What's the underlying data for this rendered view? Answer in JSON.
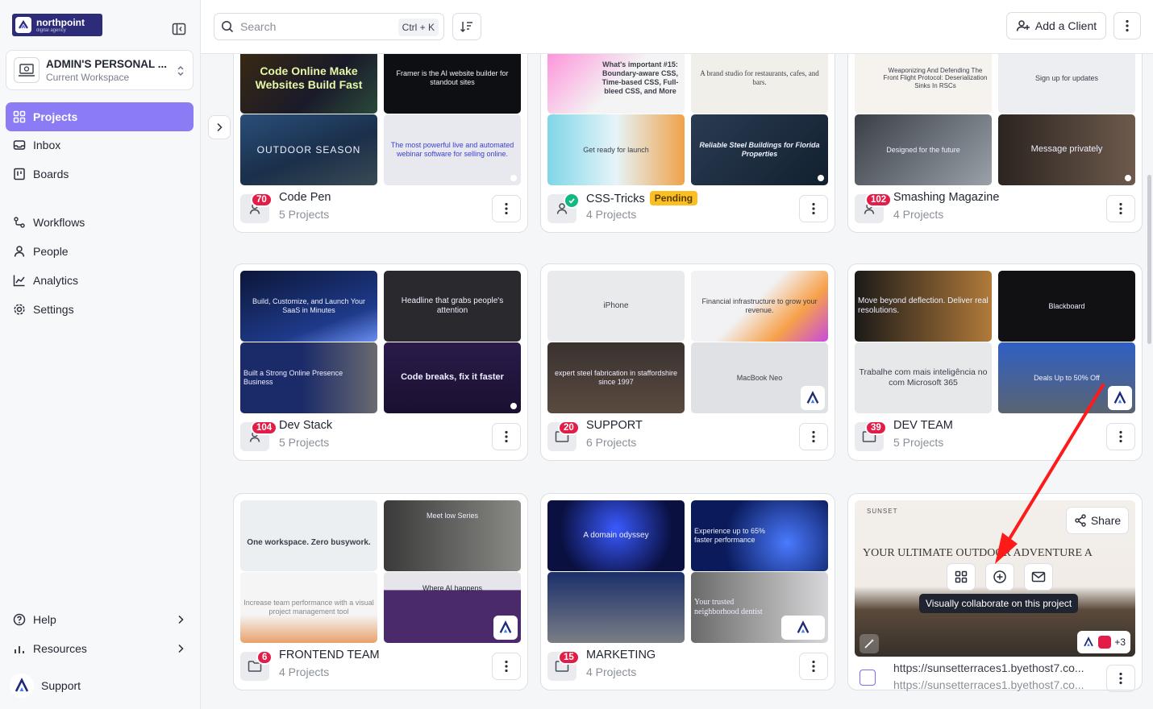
{
  "brand": {
    "name": "northpoint",
    "tagline": "digital agency"
  },
  "workspace": {
    "title": "ADMIN'S PERSONAL ...",
    "subtitle": "Current Workspace"
  },
  "nav": {
    "projects": "Projects",
    "inbox": "Inbox",
    "boards": "Boards",
    "workflows": "Workflows",
    "people": "People",
    "analytics": "Analytics",
    "settings": "Settings",
    "help": "Help",
    "resources": "Resources",
    "support": "Support"
  },
  "topbar": {
    "search_placeholder": "Search",
    "shortcut": "Ctrl + K",
    "add_client": "Add a Client"
  },
  "cards": [
    {
      "name": "Code Pen",
      "count": "70",
      "projects": "5 Projects",
      "thumbs": [
        "Code Online Make Websites Build Fast",
        "Framer is the AI website builder for standout sites",
        "OUTDOOR SEASON",
        "The most powerful live and automated webinar software for selling online."
      ]
    },
    {
      "name": "CSS-Tricks",
      "badge": "Pending",
      "projects": "4 Projects",
      "thumbs": [
        "What's important #15: Boundary-aware CSS, Time-based CSS, Full-bleed CSS, and More",
        "A brand studio for restaurants, cafes, and bars.",
        "Get ready for launch",
        "Reliable Steel Buildings for Florida Properties"
      ]
    },
    {
      "name": "Smashing Magazine",
      "count": "102",
      "projects": "4 Projects",
      "thumbs": [
        "Weaponizing And Defending The Front Flight Protocol: Deserialization Sinks In RSCs",
        "Sign up for updates",
        "Designed for the future",
        "Message privately"
      ]
    },
    {
      "name": "Dev Stack",
      "count": "104",
      "projects": "5 Projects",
      "thumbs": [
        "Build, Customize, and Launch Your SaaS in Minutes",
        "Headline that grabs people's attention",
        "Built a Strong Online Presence Business",
        "Code breaks, fix it faster"
      ]
    },
    {
      "name": "SUPPORT",
      "count": "20",
      "projects": "6 Projects",
      "thumbs": [
        "iPhone",
        "Financial infrastructure to grow your revenue.",
        "expert steel fabrication in staffordshire since 1997",
        "MacBook Neo"
      ]
    },
    {
      "name": "DEV TEAM",
      "count": "39",
      "projects": "5 Projects",
      "thumbs": [
        "Move beyond deflection. Deliver real resolutions.",
        "Blackboard",
        "Trabalhe com mais inteligência no com Microsoft 365",
        "Deals Up to 50% Off"
      ]
    },
    {
      "name": "FRONTEND TEAM",
      "count": "6",
      "projects": "4 Projects",
      "thumbs": [
        "One workspace. Zero busywork.",
        "Meet low Series",
        "Increase team performance with a visual project management tool",
        "Where AI happens"
      ]
    },
    {
      "name": "MARKETING",
      "count": "15",
      "projects": "4 Projects",
      "thumbs": [
        "A domain odyssey",
        "Experience up to 65% faster performance",
        "",
        "Your trusted neighborhood dentist"
      ]
    }
  ],
  "sunset": {
    "logo": "SUNSET",
    "hero": "YOUR ULTIMATE OUTDOOR ADVENTURE A",
    "share": "Share",
    "tooltip": "Visually collaborate on this project",
    "more_collaborators": "+3",
    "url": "https://sunsetterraces1.byethost7.co...",
    "url_sub": "https://sunsetterraces1.byethost7.co..."
  },
  "colors": {
    "accent": "#8b7cf6",
    "badge": "#e11d48",
    "pending": "#fbbf24",
    "check": "#10b981"
  }
}
